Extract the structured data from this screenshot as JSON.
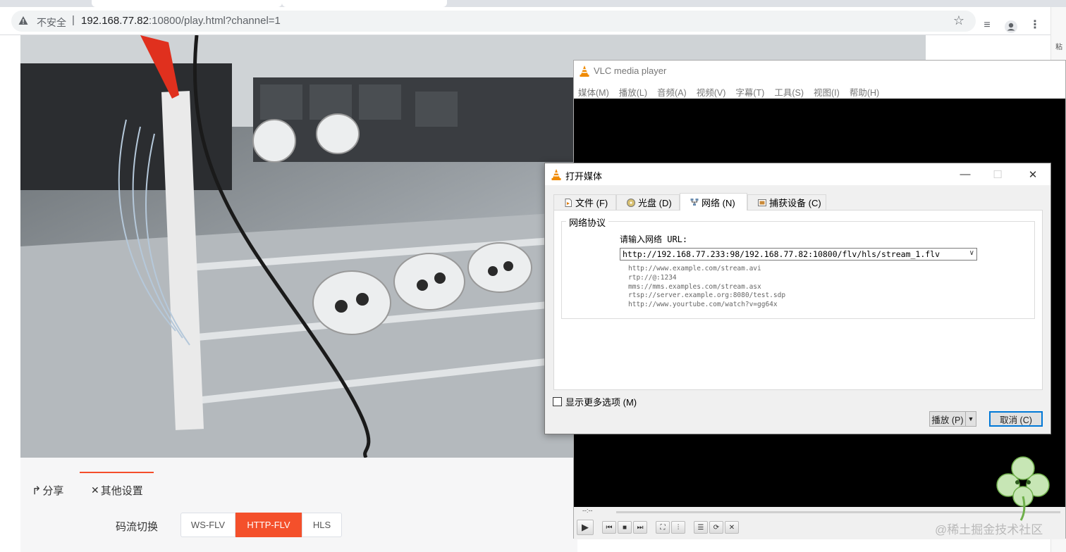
{
  "browser": {
    "insecure_label": "不安全",
    "separator": "|",
    "url_host": "192.168.77.82",
    "url_rest": ":10800/play.html?channel=1"
  },
  "right_strip": {
    "label": "粘"
  },
  "page": {
    "tabs": [
      {
        "label": "分享",
        "icon": "share-icon"
      },
      {
        "label": "其他设置",
        "icon": "settings-cross-icon"
      }
    ],
    "stream_switch_label": "码流切换",
    "stream_options": [
      "WS-FLV",
      "HTTP-FLV",
      "HLS"
    ],
    "stream_selected": "HTTP-FLV",
    "accent_color": "#f4502b"
  },
  "vlc": {
    "title": "VLC media player",
    "menu": [
      "媒体(M)",
      "播放(L)",
      "音频(A)",
      "视频(V)",
      "字幕(T)",
      "工具(S)",
      "视图(I)",
      "帮助(H)"
    ],
    "time": "--:--"
  },
  "dialog": {
    "title": "打开媒体",
    "tabs": [
      {
        "label": "文件 (F)",
        "icon": "file-icon"
      },
      {
        "label": "光盘 (D)",
        "icon": "disc-icon"
      },
      {
        "label": "网络 (N)",
        "icon": "network-icon"
      },
      {
        "label": "捕获设备 (C)",
        "icon": "capture-icon"
      }
    ],
    "active_tab": "网络 (N)",
    "group_title": "网络协议",
    "url_prompt": "请输入网络 URL:",
    "url_value": "http://192.168.77.233:98/192.168.77.82:10800/flv/hls/stream_1.flv",
    "examples": [
      "http://www.example.com/stream.avi",
      "rtp://@:1234",
      "mms://mms.examples.com/stream.asx",
      "rtsp://server.example.org:8080/test.sdp",
      "http://www.yourtube.com/watch?v=gg64x"
    ],
    "more_options": "显示更多选项 (M)",
    "play_label": "播放 (P)",
    "cancel_label": "取消 (C)"
  },
  "watermark": "@稀土掘金技术社区"
}
